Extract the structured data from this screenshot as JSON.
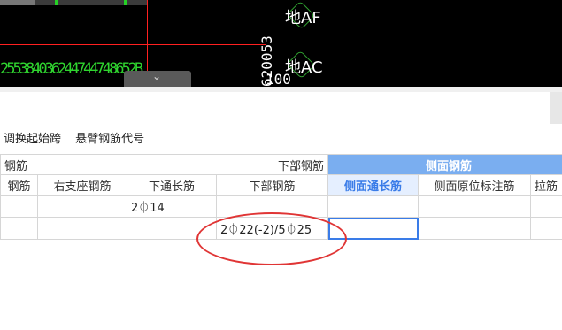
{
  "cad": {
    "axis_labels": [
      "地AF",
      "地AC"
    ],
    "vertical_number": "620053",
    "bottom_number": "100",
    "scribble_text": "255384036244744748652B"
  },
  "toolbar": {
    "buttons": [
      "调换起始跨",
      "悬臂钢筋代号"
    ]
  },
  "grid": {
    "group_headers": [
      "钢筋",
      "下部钢筋",
      "侧面钢筋"
    ],
    "column_headers": [
      "钢筋",
      "右支座钢筋",
      "下通长筋",
      "下部钢筋",
      "侧面通长筋",
      "侧面原位标注筋",
      "拉筋"
    ],
    "rows": [
      [
        "",
        "",
        "2⏀14",
        "",
        "",
        "",
        ""
      ],
      [
        "",
        "",
        "",
        "2⏀22(-2)/5⏀25",
        "",
        "",
        ""
      ]
    ]
  },
  "colors": {
    "selected_header": "#7aaef0",
    "annotation": "#e03535"
  }
}
